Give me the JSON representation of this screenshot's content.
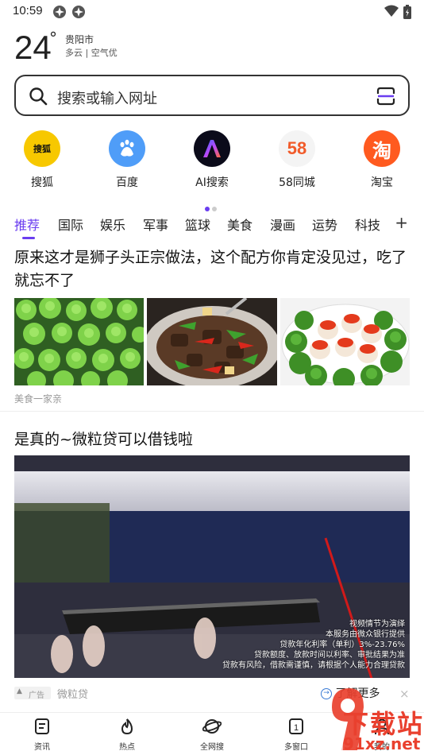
{
  "status_bar": {
    "time": "10:59"
  },
  "weather": {
    "temperature": "24",
    "degree": "°",
    "city": "贵阳市",
    "condition": "多云 | 空气优"
  },
  "search": {
    "placeholder": "搜索或输入网址"
  },
  "shortcuts": [
    {
      "label": "搜狐",
      "icon": "sohu-logo",
      "color": "#f7c800",
      "logo_text": "搜狐"
    },
    {
      "label": "百度",
      "icon": "baidu-paw-icon",
      "color": "#4f9df8"
    },
    {
      "label": "AI搜索",
      "icon": "ai-search-logo",
      "color": "#0b0b1a"
    },
    {
      "label": "58同城",
      "icon": "58-logo",
      "color": "#f4f4f4",
      "logo_text": "58"
    },
    {
      "label": "淘宝",
      "icon": "taobao-logo",
      "color": "#ff5a1f",
      "logo_text": "淘"
    }
  ],
  "page_indicator": {
    "count": 2,
    "active": 0
  },
  "tabs": [
    "推荐",
    "国际",
    "娱乐",
    "军事",
    "篮球",
    "美食",
    "漫画",
    "运势",
    "科技"
  ],
  "tabs_add": "+",
  "feed": {
    "article1": {
      "title": "原来这才是狮子头正宗做法，这个配方你肯定没见过，吃了就忘不了",
      "source": "美食一家亲"
    },
    "article2": {
      "title": "是真的~微粒贷可以借钱啦",
      "video_caption": [
        "视频情节为演绎",
        "本服务由微众银行提供",
        "贷款年化利率（单利）3%-23.76%",
        "贷款额度、放款时间以利率、审批结果为准",
        "贷款有风险，借款需谨慎，请根据个人能力合理贷款"
      ],
      "ad_badge": "广告",
      "ad_source": "微粒贷",
      "learn_more": "了解更多",
      "close": "×"
    }
  },
  "bottom_nav": [
    {
      "label": "资讯",
      "icon": "news-icon"
    },
    {
      "label": "热点",
      "icon": "flame-icon"
    },
    {
      "label": "全网搜",
      "icon": "planet-icon"
    },
    {
      "label": "多窗口",
      "icon": "windows-icon",
      "badge": "1"
    },
    {
      "label": "我的",
      "icon": "profile-icon"
    }
  ],
  "watermark": {
    "line1": "下载站",
    "line2": "91xz.net",
    "logo": "91"
  },
  "colors": {
    "accent": "#6a3df0",
    "text": "#111111",
    "muted": "#999999",
    "watermark": "#e9402e"
  }
}
